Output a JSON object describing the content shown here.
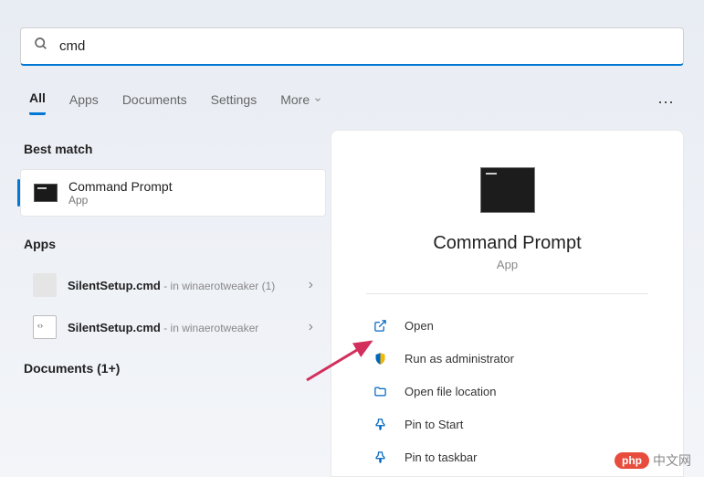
{
  "search": {
    "value": "cmd"
  },
  "tabs": {
    "all": "All",
    "apps": "Apps",
    "documents": "Documents",
    "settings": "Settings",
    "more": "More"
  },
  "sections": {
    "best_match": "Best match",
    "apps": "Apps",
    "documents": "Documents (1+)"
  },
  "best": {
    "title": "Command Prompt",
    "sub": "App"
  },
  "app_items": [
    {
      "name": "SilentSetup.cmd",
      "loc": " - in winaerotweaker (1)"
    },
    {
      "name": "SilentSetup.cmd",
      "loc": " - in winaerotweaker"
    }
  ],
  "panel": {
    "title": "Command Prompt",
    "sub": "App"
  },
  "actions": {
    "open": "Open",
    "admin": "Run as administrator",
    "location": "Open file location",
    "pin_start": "Pin to Start",
    "pin_taskbar": "Pin to taskbar"
  },
  "watermark": {
    "badge": "php",
    "text": "中文网"
  }
}
